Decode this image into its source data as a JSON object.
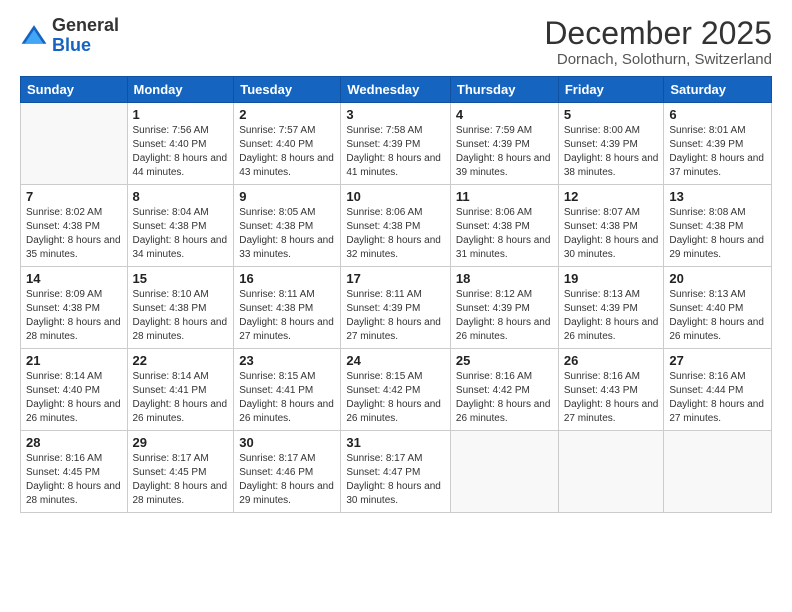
{
  "logo": {
    "general": "General",
    "blue": "Blue"
  },
  "header": {
    "month": "December 2025",
    "location": "Dornach, Solothurn, Switzerland"
  },
  "weekdays": [
    "Sunday",
    "Monday",
    "Tuesday",
    "Wednesday",
    "Thursday",
    "Friday",
    "Saturday"
  ],
  "weeks": [
    [
      {
        "day": "",
        "empty": true
      },
      {
        "day": "1",
        "sunrise": "7:56 AM",
        "sunset": "4:40 PM",
        "daylight": "8 hours and 44 minutes."
      },
      {
        "day": "2",
        "sunrise": "7:57 AM",
        "sunset": "4:40 PM",
        "daylight": "8 hours and 43 minutes."
      },
      {
        "day": "3",
        "sunrise": "7:58 AM",
        "sunset": "4:39 PM",
        "daylight": "8 hours and 41 minutes."
      },
      {
        "day": "4",
        "sunrise": "7:59 AM",
        "sunset": "4:39 PM",
        "daylight": "8 hours and 39 minutes."
      },
      {
        "day": "5",
        "sunrise": "8:00 AM",
        "sunset": "4:39 PM",
        "daylight": "8 hours and 38 minutes."
      },
      {
        "day": "6",
        "sunrise": "8:01 AM",
        "sunset": "4:39 PM",
        "daylight": "8 hours and 37 minutes."
      }
    ],
    [
      {
        "day": "7",
        "sunrise": "8:02 AM",
        "sunset": "4:38 PM",
        "daylight": "8 hours and 35 minutes."
      },
      {
        "day": "8",
        "sunrise": "8:04 AM",
        "sunset": "4:38 PM",
        "daylight": "8 hours and 34 minutes."
      },
      {
        "day": "9",
        "sunrise": "8:05 AM",
        "sunset": "4:38 PM",
        "daylight": "8 hours and 33 minutes."
      },
      {
        "day": "10",
        "sunrise": "8:06 AM",
        "sunset": "4:38 PM",
        "daylight": "8 hours and 32 minutes."
      },
      {
        "day": "11",
        "sunrise": "8:06 AM",
        "sunset": "4:38 PM",
        "daylight": "8 hours and 31 minutes."
      },
      {
        "day": "12",
        "sunrise": "8:07 AM",
        "sunset": "4:38 PM",
        "daylight": "8 hours and 30 minutes."
      },
      {
        "day": "13",
        "sunrise": "8:08 AM",
        "sunset": "4:38 PM",
        "daylight": "8 hours and 29 minutes."
      }
    ],
    [
      {
        "day": "14",
        "sunrise": "8:09 AM",
        "sunset": "4:38 PM",
        "daylight": "8 hours and 28 minutes."
      },
      {
        "day": "15",
        "sunrise": "8:10 AM",
        "sunset": "4:38 PM",
        "daylight": "8 hours and 28 minutes."
      },
      {
        "day": "16",
        "sunrise": "8:11 AM",
        "sunset": "4:38 PM",
        "daylight": "8 hours and 27 minutes."
      },
      {
        "day": "17",
        "sunrise": "8:11 AM",
        "sunset": "4:39 PM",
        "daylight": "8 hours and 27 minutes."
      },
      {
        "day": "18",
        "sunrise": "8:12 AM",
        "sunset": "4:39 PM",
        "daylight": "8 hours and 26 minutes."
      },
      {
        "day": "19",
        "sunrise": "8:13 AM",
        "sunset": "4:39 PM",
        "daylight": "8 hours and 26 minutes."
      },
      {
        "day": "20",
        "sunrise": "8:13 AM",
        "sunset": "4:40 PM",
        "daylight": "8 hours and 26 minutes."
      }
    ],
    [
      {
        "day": "21",
        "sunrise": "8:14 AM",
        "sunset": "4:40 PM",
        "daylight": "8 hours and 26 minutes."
      },
      {
        "day": "22",
        "sunrise": "8:14 AM",
        "sunset": "4:41 PM",
        "daylight": "8 hours and 26 minutes."
      },
      {
        "day": "23",
        "sunrise": "8:15 AM",
        "sunset": "4:41 PM",
        "daylight": "8 hours and 26 minutes."
      },
      {
        "day": "24",
        "sunrise": "8:15 AM",
        "sunset": "4:42 PM",
        "daylight": "8 hours and 26 minutes."
      },
      {
        "day": "25",
        "sunrise": "8:16 AM",
        "sunset": "4:42 PM",
        "daylight": "8 hours and 26 minutes."
      },
      {
        "day": "26",
        "sunrise": "8:16 AM",
        "sunset": "4:43 PM",
        "daylight": "8 hours and 27 minutes."
      },
      {
        "day": "27",
        "sunrise": "8:16 AM",
        "sunset": "4:44 PM",
        "daylight": "8 hours and 27 minutes."
      }
    ],
    [
      {
        "day": "28",
        "sunrise": "8:16 AM",
        "sunset": "4:45 PM",
        "daylight": "8 hours and 28 minutes."
      },
      {
        "day": "29",
        "sunrise": "8:17 AM",
        "sunset": "4:45 PM",
        "daylight": "8 hours and 28 minutes."
      },
      {
        "day": "30",
        "sunrise": "8:17 AM",
        "sunset": "4:46 PM",
        "daylight": "8 hours and 29 minutes."
      },
      {
        "day": "31",
        "sunrise": "8:17 AM",
        "sunset": "4:47 PM",
        "daylight": "8 hours and 30 minutes."
      },
      {
        "day": "",
        "empty": true
      },
      {
        "day": "",
        "empty": true
      },
      {
        "day": "",
        "empty": true
      }
    ]
  ]
}
